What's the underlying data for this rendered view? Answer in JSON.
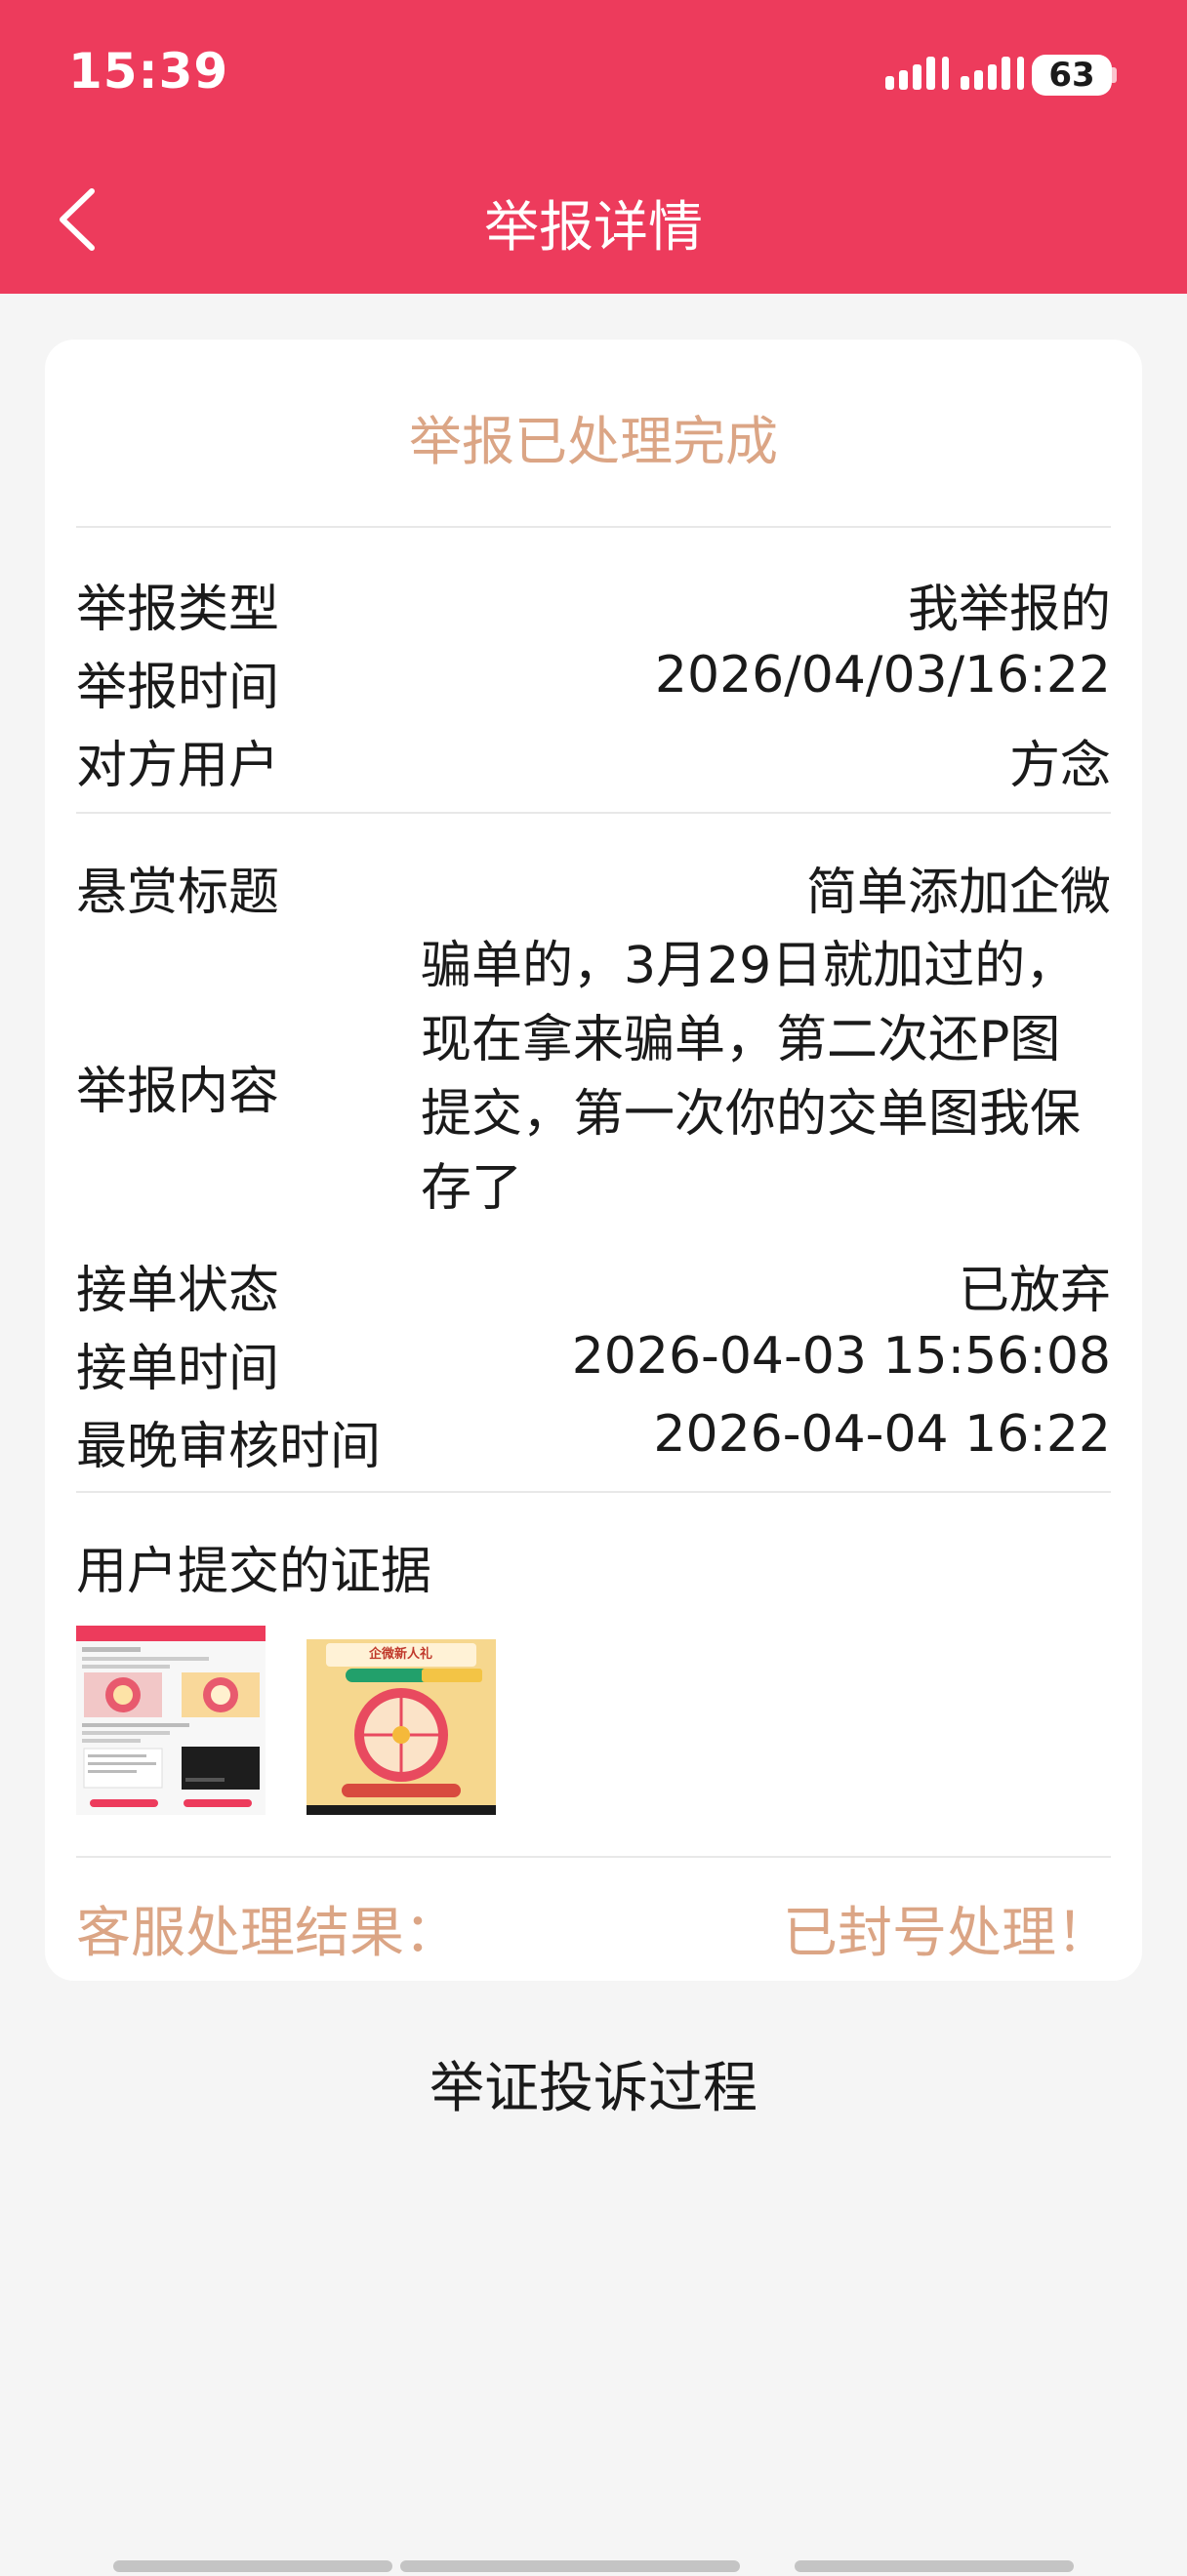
{
  "status_bar": {
    "time": "15:39",
    "battery": "63"
  },
  "nav": {
    "title": "举报详情"
  },
  "card": {
    "status": "举报已处理完成",
    "report_type": {
      "label": "举报类型",
      "value": "我举报的"
    },
    "report_time": {
      "label": "举报时间",
      "value": "2026/04/03/16:22"
    },
    "other_user": {
      "label": "对方用户",
      "value": "方念"
    },
    "reward_title": {
      "label": "悬赏标题",
      "value": "简单添加企微"
    },
    "report_content": {
      "label": "举报内容",
      "value": "骗单的，3月29日就加过的，现在拿来骗单，第二次还P图提交，第一次你的交单图我保存了"
    },
    "order_status": {
      "label": "接单状态",
      "value": "已放弃"
    },
    "order_time": {
      "label": "接单时间",
      "value": "2026-04-03 15:56:08"
    },
    "latest_review_time": {
      "label": "最晚审核时间",
      "value": "2026-04-04 16:22"
    },
    "evidence": {
      "title": "用户提交的证据",
      "images": [
        {
          "type": "screenshot"
        },
        {
          "type": "screenshot",
          "caption": "企微新人礼"
        }
      ]
    },
    "result": {
      "label": "客服处理结果：",
      "value": "已封号处理！"
    }
  },
  "process_link": "举证投诉过程",
  "colors": {
    "accent": "#ed3b5c",
    "highlight": "#dba585",
    "background": "#f5f5f5"
  }
}
